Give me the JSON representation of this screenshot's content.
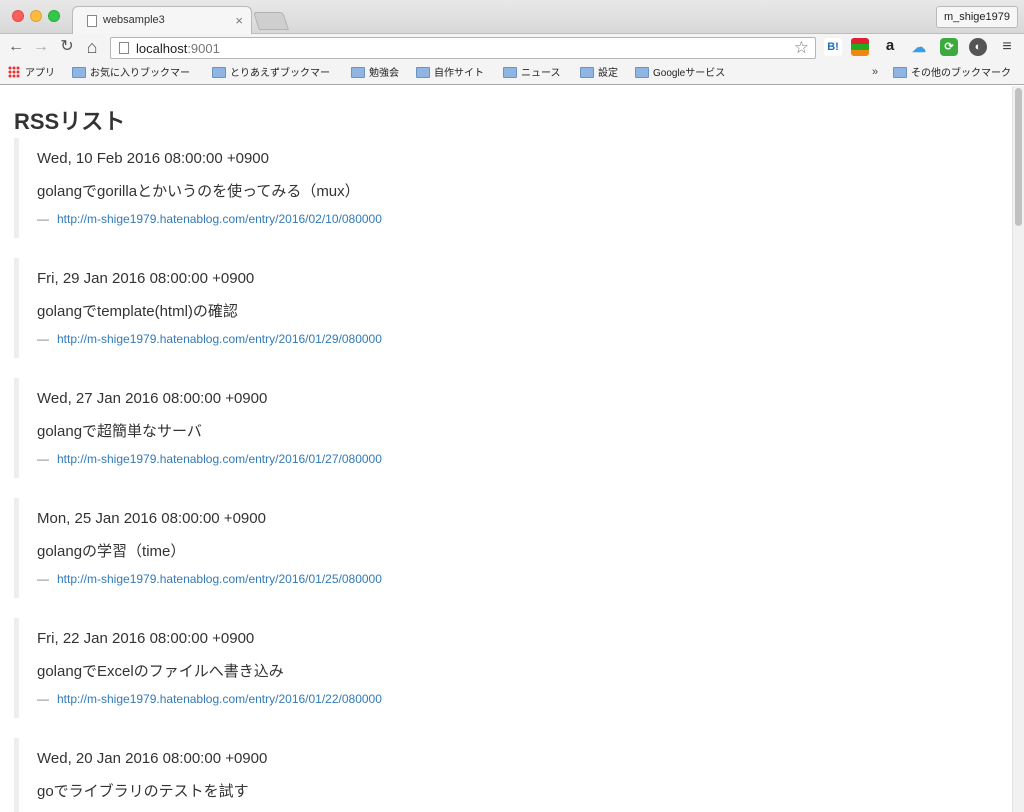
{
  "window": {
    "tab_title": "websample3",
    "tab_close": "×",
    "profile_name": "m_shige1979"
  },
  "toolbar": {
    "back": "←",
    "forward": "→",
    "reload": "↻",
    "home": "⌂",
    "url_host": "localhost",
    "url_port": ":9001",
    "star": "☆",
    "ext_hatena": "B!",
    "ext_amazon": "a",
    "ext_cloud": "☁",
    "ext_green": "⟳",
    "ext_dial": "◐",
    "menu": "≡"
  },
  "bookmarks": {
    "apps": "アプリ",
    "items": [
      "お気に入りブックマー",
      "とりあえずブックマー",
      "勉強会",
      "自作サイト",
      "ニュース",
      "設定",
      "Googleサービス"
    ],
    "more": "»",
    "other": "その他のブックマーク"
  },
  "page": {
    "title_bold": "RSS",
    "title_rest": "リスト",
    "dash": "—",
    "entries": [
      {
        "date": "Wed, 10 Feb 2016 08:00:00 +0900",
        "title": "golangでgorillaとかいうのを使ってみる（mux）",
        "link": "http://m-shige1979.hatenablog.com/entry/2016/02/10/080000"
      },
      {
        "date": "Fri, 29 Jan 2016 08:00:00 +0900",
        "title": "golangでtemplate(html)の確認",
        "link": "http://m-shige1979.hatenablog.com/entry/2016/01/29/080000"
      },
      {
        "date": "Wed, 27 Jan 2016 08:00:00 +0900",
        "title": "golangで超簡単なサーバ",
        "link": "http://m-shige1979.hatenablog.com/entry/2016/01/27/080000"
      },
      {
        "date": "Mon, 25 Jan 2016 08:00:00 +0900",
        "title": "golangの学習（time）",
        "link": "http://m-shige1979.hatenablog.com/entry/2016/01/25/080000"
      },
      {
        "date": "Fri, 22 Jan 2016 08:00:00 +0900",
        "title": "golangでExcelのファイルへ書き込み",
        "link": "http://m-shige1979.hatenablog.com/entry/2016/01/22/080000"
      },
      {
        "date": "Wed, 20 Jan 2016 08:00:00 +0900",
        "title": "goでライブラリのテストを試す",
        "link": ""
      }
    ]
  }
}
